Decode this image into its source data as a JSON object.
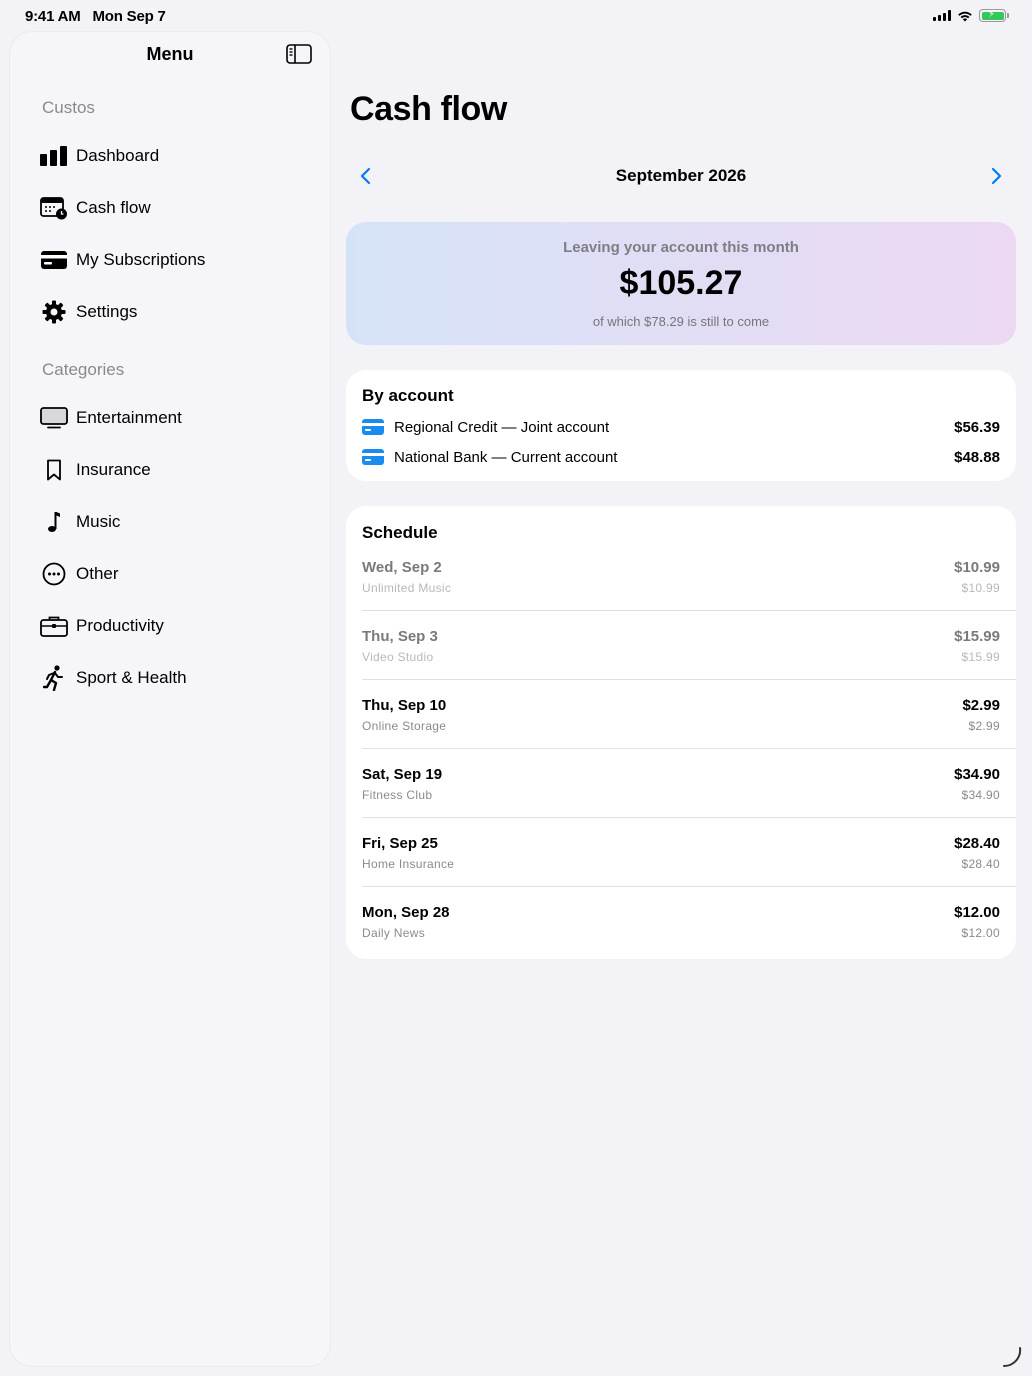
{
  "status": {
    "time": "9:41 AM",
    "date": "Mon Sep 7"
  },
  "sidebar": {
    "title": "Menu",
    "sections": [
      {
        "header": "Custos",
        "items": [
          {
            "label": "Dashboard",
            "icon": "chart-bar-icon"
          },
          {
            "label": "Cash flow",
            "icon": "calendar-clock-icon"
          },
          {
            "label": "My Subscriptions",
            "icon": "credit-card-icon"
          },
          {
            "label": "Settings",
            "icon": "gear-icon"
          }
        ]
      },
      {
        "header": "Categories",
        "items": [
          {
            "label": "Entertainment",
            "icon": "tv-icon"
          },
          {
            "label": "Insurance",
            "icon": "bookmark-icon"
          },
          {
            "label": "Music",
            "icon": "music-note-icon"
          },
          {
            "label": "Other",
            "icon": "ellipsis-circle-icon"
          },
          {
            "label": "Productivity",
            "icon": "briefcase-icon"
          },
          {
            "label": "Sport & Health",
            "icon": "figure-run-icon"
          }
        ]
      }
    ]
  },
  "main": {
    "title": "Cash flow",
    "month": "September 2026",
    "summary": {
      "caption": "Leaving your account this month",
      "amount": "$105.27",
      "note": "of which $78.29 is still to come"
    },
    "by_account": {
      "title": "By account",
      "rows": [
        {
          "name": "Regional Credit — Joint account",
          "amount": "$56.39"
        },
        {
          "name": "National Bank — Current account",
          "amount": "$48.88"
        }
      ]
    },
    "schedule": {
      "title": "Schedule",
      "rows": [
        {
          "date": "Wed, Sep 2",
          "name": "Unlimited Music",
          "amount": "$10.99",
          "sub_amount": "$10.99",
          "past": true
        },
        {
          "date": "Thu, Sep 3",
          "name": "Video Studio",
          "amount": "$15.99",
          "sub_amount": "$15.99",
          "past": true
        },
        {
          "date": "Thu, Sep 10",
          "name": "Online Storage",
          "amount": "$2.99",
          "sub_amount": "$2.99",
          "past": false
        },
        {
          "date": "Sat, Sep 19",
          "name": "Fitness Club",
          "amount": "$34.90",
          "sub_amount": "$34.90",
          "past": false
        },
        {
          "date": "Fri, Sep 25",
          "name": "Home Insurance",
          "amount": "$28.40",
          "sub_amount": "$28.40",
          "past": false
        },
        {
          "date": "Mon, Sep 28",
          "name": "Daily News",
          "amount": "$12.00",
          "sub_amount": "$12.00",
          "past": false
        }
      ]
    }
  },
  "colors": {
    "accent": "#007aff",
    "card_blue": "#1a8cf0",
    "battery_green": "#34c759"
  }
}
